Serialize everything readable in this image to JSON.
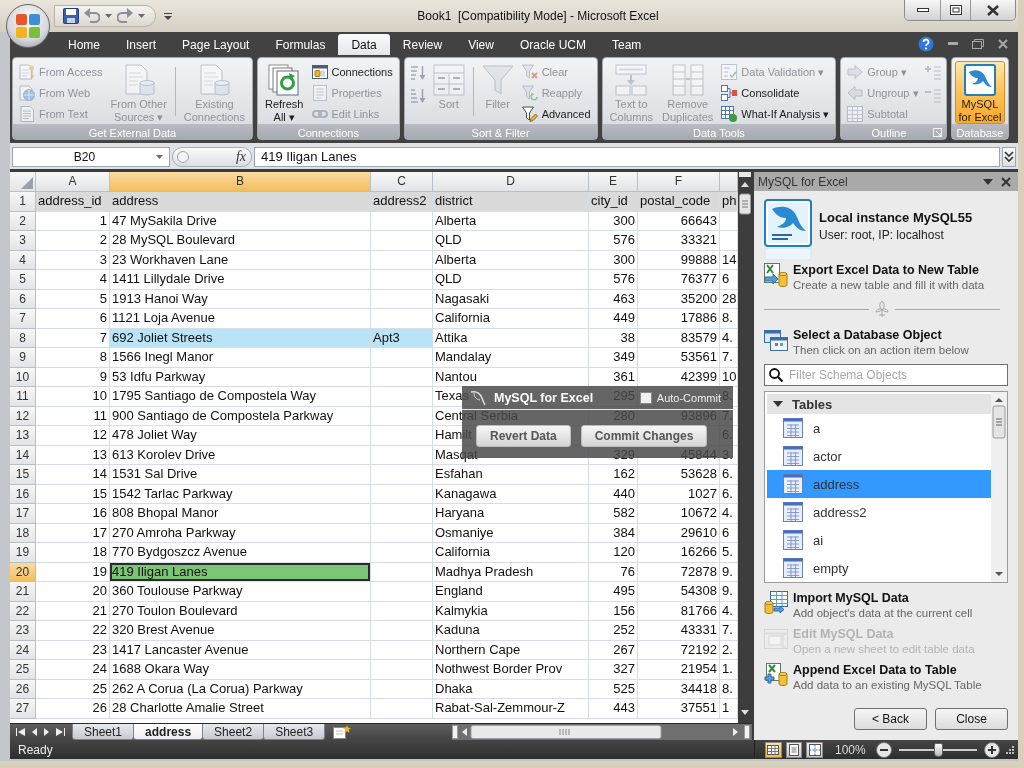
{
  "window": {
    "title": "Book1  [Compatibility Mode] - Microsoft Excel"
  },
  "ribbon": {
    "tabs": [
      {
        "label": "Home",
        "selected": false
      },
      {
        "label": "Insert",
        "selected": false
      },
      {
        "label": "Page Layout",
        "selected": false
      },
      {
        "label": "Formulas",
        "selected": false
      },
      {
        "label": "Data",
        "selected": true
      },
      {
        "label": "Review",
        "selected": false
      },
      {
        "label": "View",
        "selected": false
      },
      {
        "label": "Oracle UCM",
        "selected": false
      },
      {
        "label": "Team",
        "selected": false
      }
    ],
    "groups": [
      {
        "label": "Get External Data",
        "dialog_launcher": false,
        "items": [
          {
            "kind": "stack",
            "buttons": [
              {
                "label": "From Access",
                "disabled": true
              },
              {
                "label": "From Web",
                "disabled": true
              },
              {
                "label": "From Text",
                "disabled": true
              }
            ]
          },
          {
            "kind": "large",
            "label": "From Other\nSources ▾",
            "disabled": true
          },
          {
            "kind": "divider"
          },
          {
            "kind": "large",
            "label": "Existing\nConnections",
            "disabled": true
          }
        ]
      },
      {
        "label": "Connections",
        "dialog_launcher": false,
        "items": [
          {
            "kind": "large",
            "label": "Refresh\nAll ▾",
            "disabled": false
          },
          {
            "kind": "stack",
            "buttons": [
              {
                "label": "Connections",
                "disabled": false
              },
              {
                "label": "Properties",
                "disabled": true
              },
              {
                "label": "Edit Links",
                "disabled": true
              }
            ]
          }
        ]
      },
      {
        "label": "Sort & Filter",
        "dialog_launcher": false,
        "items": [
          {
            "kind": "stack",
            "buttons": [
              {
                "disabled": true
              },
              {
                "disabled": true
              }
            ]
          },
          {
            "kind": "large",
            "label": "Sort",
            "disabled": true
          },
          {
            "kind": "divider"
          },
          {
            "kind": "large",
            "label": "Filter",
            "disabled": true
          },
          {
            "kind": "stack",
            "buttons": [
              {
                "label": "Clear",
                "disabled": true
              },
              {
                "label": "Reapply",
                "disabled": true
              },
              {
                "label": "Advanced",
                "disabled": false
              }
            ]
          }
        ]
      },
      {
        "label": "Data Tools",
        "dialog_launcher": false,
        "items": [
          {
            "kind": "large",
            "label": "Text to\nColumns",
            "disabled": true
          },
          {
            "kind": "large",
            "label": "Remove\nDuplicates",
            "disabled": true
          },
          {
            "kind": "stack",
            "buttons": [
              {
                "label": "Data Validation ▾",
                "disabled": true
              },
              {
                "label": "Consolidate",
                "disabled": false
              },
              {
                "label": "What-If Analysis ▾",
                "disabled": false
              }
            ]
          }
        ]
      },
      {
        "label": "Outline",
        "dialog_launcher": true,
        "items": [
          {
            "kind": "stack",
            "buttons": [
              {
                "label": "Group ▾",
                "disabled": true
              },
              {
                "label": "Ungroup ▾",
                "disabled": true
              },
              {
                "label": "Subtotal",
                "disabled": true
              }
            ]
          },
          {
            "kind": "stack",
            "buttons": [
              {
                "disabled": true
              },
              {
                "disabled": true
              }
            ]
          }
        ]
      },
      {
        "label": "Database",
        "dialog_launcher": false,
        "items": [
          {
            "kind": "large",
            "label": "MySQL\nfor Excel",
            "disabled": false,
            "pressed": true
          }
        ]
      }
    ]
  },
  "formula_bar": {
    "name_box": "B20",
    "function_label": "fx",
    "value": "419 Iligan Lanes"
  },
  "sheet": {
    "columns": [
      {
        "letter": "A",
        "kind": "number",
        "selected": false
      },
      {
        "letter": "B",
        "kind": "text",
        "selected": true
      },
      {
        "letter": "C",
        "kind": "text",
        "selected": false
      },
      {
        "letter": "D",
        "kind": "text",
        "selected": false
      },
      {
        "letter": "E",
        "kind": "number",
        "selected": false
      },
      {
        "letter": "F",
        "kind": "number",
        "selected": false
      },
      {
        "kind": "text",
        "selected": false
      }
    ],
    "rows": [
      {
        "number": "1",
        "kind": "header",
        "selected": false,
        "cells": [
          "address_id",
          "address",
          "address2",
          "district",
          "city_id",
          "postal_code",
          "ph"
        ]
      },
      {
        "number": "2",
        "kind": "data",
        "selected": false,
        "cells": [
          "1",
          "47 MySakila Drive",
          null,
          "Alberta",
          "300",
          "66643",
          null
        ]
      },
      {
        "number": "3",
        "kind": "data",
        "selected": false,
        "cells": [
          "2",
          "28 MySQL Boulevard",
          null,
          "QLD",
          "576",
          "33321",
          null
        ]
      },
      {
        "number": "4",
        "kind": "data",
        "selected": false,
        "cells": [
          "3",
          "23 Workhaven Lane",
          null,
          "Alberta",
          "300",
          "99888",
          "14"
        ]
      },
      {
        "number": "5",
        "kind": "data",
        "selected": false,
        "cells": [
          "4",
          "1411 Lillydale Drive",
          null,
          "QLD",
          "576",
          "76377",
          "6"
        ]
      },
      {
        "number": "6",
        "kind": "data",
        "selected": false,
        "cells": [
          "5",
          "1913 Hanoi Way",
          null,
          "Nagasaki",
          "463",
          "35200",
          "28"
        ]
      },
      {
        "number": "7",
        "kind": "data",
        "selected": false,
        "cells": [
          "6",
          "1121 Loja Avenue",
          null,
          "California",
          "449",
          "17886",
          "8."
        ]
      },
      {
        "number": "8",
        "kind": "data",
        "selected": false,
        "cells": [
          "7",
          {
            "text": "692 Joliet Streets",
            "color": "#b9e3f6"
          },
          {
            "text": "Apt3",
            "color": "#b9e3f6"
          },
          "Attika",
          "38",
          "83579",
          "4."
        ]
      },
      {
        "number": "9",
        "kind": "data",
        "selected": false,
        "cells": [
          "8",
          "1566 Inegl Manor",
          null,
          "Mandalay",
          "349",
          "53561",
          "7."
        ]
      },
      {
        "number": "10",
        "kind": "data",
        "selected": false,
        "cells": [
          "9",
          "53 Idfu Parkway",
          null,
          "Nantou",
          "361",
          "42399",
          "10"
        ]
      },
      {
        "number": "11",
        "kind": "data",
        "selected": false,
        "cells": [
          "10",
          "1795 Santiago de Compostela Way",
          null,
          "Texas",
          "295",
          null,
          "8."
        ]
      },
      {
        "number": "12",
        "kind": "data",
        "selected": false,
        "cells": [
          "11",
          "900 Santiago de Compostela Parkway",
          null,
          "Central Serbia",
          "280",
          "93896",
          "7."
        ]
      },
      {
        "number": "13",
        "kind": "data",
        "selected": false,
        "cells": [
          "12",
          "478 Joliet Way",
          null,
          "Hamilt",
          null,
          null,
          "6."
        ]
      },
      {
        "number": "14",
        "kind": "data",
        "selected": false,
        "cells": [
          "13",
          "613 Korolev Drive",
          null,
          "Masqat",
          "329",
          "45844",
          "3."
        ]
      },
      {
        "number": "15",
        "kind": "data",
        "selected": false,
        "cells": [
          "14",
          "1531 Sal Drive",
          null,
          "Esfahan",
          "162",
          "53628",
          "6."
        ]
      },
      {
        "number": "16",
        "kind": "data",
        "selected": false,
        "cells": [
          "15",
          "1542 Tarlac Parkway",
          null,
          "Kanagawa",
          "440",
          "1027",
          "6."
        ]
      },
      {
        "number": "17",
        "kind": "data",
        "selected": false,
        "cells": [
          "16",
          "808 Bhopal Manor",
          null,
          "Haryana",
          "582",
          "10672",
          "4."
        ]
      },
      {
        "number": "18",
        "kind": "data",
        "selected": false,
        "cells": [
          "17",
          "270 Amroha Parkway",
          null,
          "Osmaniye",
          "384",
          "29610",
          "6"
        ]
      },
      {
        "number": "19",
        "kind": "data",
        "selected": false,
        "cells": [
          "18",
          "770 Bydgoszcz Avenue",
          null,
          "California",
          "120",
          "16266",
          "5."
        ]
      },
      {
        "number": "20",
        "kind": "data",
        "selected": true,
        "cells": [
          "19",
          {
            "text": "419 Iligan Lanes",
            "color": "#7cc576"
          },
          null,
          "Madhya Pradesh",
          "76",
          "72878",
          "9."
        ]
      },
      {
        "number": "21",
        "kind": "data",
        "selected": false,
        "cells": [
          "20",
          "360 Toulouse Parkway",
          null,
          "England",
          "495",
          "54308",
          "9."
        ]
      },
      {
        "number": "22",
        "kind": "data",
        "selected": false,
        "cells": [
          "21",
          "270 Toulon Boulevard",
          null,
          "Kalmykia",
          "156",
          "81766",
          "4."
        ]
      },
      {
        "number": "23",
        "kind": "data",
        "selected": false,
        "cells": [
          "22",
          "320 Brest Avenue",
          null,
          "Kaduna",
          "252",
          "43331",
          "7."
        ]
      },
      {
        "number": "24",
        "kind": "data",
        "selected": false,
        "cells": [
          "23",
          "1417 Lancaster Avenue",
          null,
          "Northern Cape",
          "267",
          "72192",
          "2."
        ]
      },
      {
        "number": "25",
        "kind": "data",
        "selected": false,
        "cells": [
          "24",
          "1688 Okara Way",
          null,
          "Nothwest Border Prov",
          "327",
          "21954",
          "1."
        ]
      },
      {
        "number": "26",
        "kind": "data",
        "selected": false,
        "cells": [
          "25",
          "262 A Corua (La Corua) Parkway",
          null,
          "Dhaka",
          "525",
          "34418",
          "8."
        ]
      },
      {
        "number": "27",
        "kind": "data",
        "selected": false,
        "cells": [
          "26",
          "28 Charlotte Amalie Street",
          null,
          "Rabat-Sal-Zemmour-Z",
          "443",
          "37551",
          "1"
        ]
      }
    ]
  },
  "edit_toolbar": {
    "title": "MySQL for Excel",
    "auto_commit": {
      "label": "Auto-Commit",
      "checked": false
    },
    "buttons": [
      "Revert Data",
      "Commit Changes"
    ]
  },
  "sheet_tabs": [
    {
      "label": "Sheet1",
      "selected": false
    },
    {
      "label": "address",
      "selected": true
    },
    {
      "label": "Sheet2",
      "selected": false
    },
    {
      "label": "Sheet3",
      "selected": false
    }
  ],
  "panel": {
    "title": "MySQL for Excel",
    "connection": {
      "name": "Local instance MySQL55",
      "details": "User: root, IP: localhost"
    },
    "export_action": {
      "title": "Export Excel Data to New Table",
      "description": "Create a new table and fill it with data",
      "disabled": false
    },
    "select_heading": {
      "title": "Select a Database Object",
      "description": "Then click on an action item below"
    },
    "filter": {
      "placeholder": "Filter Schema Objects"
    },
    "tree": [
      {
        "label": "Tables",
        "expanded": true,
        "children": [
          {
            "label": "a",
            "selected": false
          },
          {
            "label": "actor",
            "selected": false
          },
          {
            "label": "address",
            "selected": true
          },
          {
            "label": "address2",
            "selected": false
          },
          {
            "label": "ai",
            "selected": false
          },
          {
            "label": "empty",
            "selected": false
          }
        ]
      }
    ],
    "actions": [
      {
        "title": "Import MySQL Data",
        "description": "Add object's data at the current cell",
        "disabled": false
      },
      {
        "title": "Edit MySQL Data",
        "description": "Open a new sheet to edit table data",
        "disabled": true
      },
      {
        "title": "Append Excel Data to Table",
        "description": "Add data to an existing MySQL Table",
        "disabled": false
      }
    ],
    "buttons": [
      "< Back",
      "Close"
    ]
  },
  "status_bar": {
    "text": "Ready",
    "views": [
      {
        "selected": true
      },
      {
        "selected": false
      },
      {
        "selected": false
      }
    ],
    "zoom": {
      "label": "100%",
      "level": 0.5
    }
  }
}
